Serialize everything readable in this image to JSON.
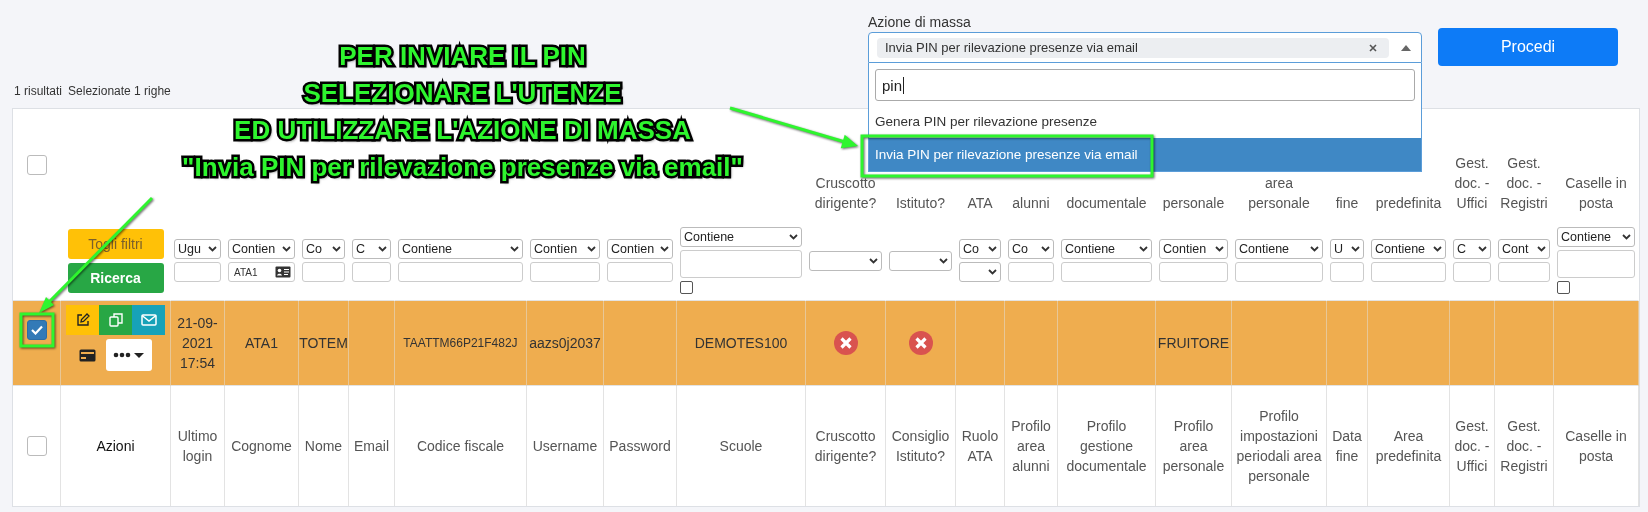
{
  "mass_action": {
    "label": "Azione di massa",
    "expanded": true,
    "value": "Invia PIN per rilevazione presenze via email",
    "search": "pin",
    "options": [
      {
        "label": "Genera PIN per rilevazione presenze",
        "selected": false
      },
      {
        "label": "Invia PIN per rilevazione presenze via email",
        "selected": true
      }
    ]
  },
  "proceed_button": "Procedi",
  "result_count": "1 risultati",
  "selection_info": "Selezionate 1 righe",
  "annotation": {
    "lines": [
      "PER INVIARE IL PIN",
      "SELEZIONARE L'UTENZE",
      "ED UTILIZZARE L'AZIONE DI MASSA",
      "\"Invia PIN per rilevazione presenze via email\""
    ]
  },
  "table": {
    "select_all_top": {
      "checked": false
    },
    "select_all_bottom": {
      "checked": false
    },
    "actions_label": "Azioni",
    "filter_buttons": [
      {
        "label": "Togli filtri",
        "kind": "clear"
      },
      {
        "label": "Ricerca",
        "kind": "search"
      }
    ],
    "columns": [
      {
        "label": "Ultimo login",
        "filter": {
          "kind": "select-input",
          "select": "Ugu"
        }
      },
      {
        "label": "Cognome",
        "filter": {
          "kind": "select-input",
          "select": "Contien",
          "value": "ATA1"
        }
      },
      {
        "label": "Nome",
        "filter": {
          "kind": "select-input",
          "select": "Co"
        }
      },
      {
        "label": "Email",
        "filter": {
          "kind": "select-input",
          "select": "C"
        }
      },
      {
        "label": "Codice fiscale",
        "filter": {
          "kind": "select-input",
          "select": "Contiene"
        }
      },
      {
        "label": "Username",
        "filter": {
          "kind": "select-input",
          "select": "Contien"
        }
      },
      {
        "label": "Password",
        "filter": {
          "kind": "select-input",
          "select": "Contien"
        }
      },
      {
        "label": "Scuole",
        "filter": {
          "kind": "select-textarea-check",
          "select": "Contiene",
          "checked": false
        }
      },
      {
        "label": "Cruscotto dirigente?",
        "top_label": "Cruscotto dirigente?",
        "filter": {
          "kind": "select"
        }
      },
      {
        "label": "Consiglio Istituto?",
        "top_label": "Istituto?",
        "filter": {
          "kind": "select"
        }
      },
      {
        "label": "Ruolo ATA",
        "top_label": "ATA",
        "filter": {
          "kind": "select-select",
          "select": "Co"
        }
      },
      {
        "label": "Profilo area alunni",
        "top_label": "alunni",
        "filter": {
          "kind": "select-input",
          "select": "Co"
        }
      },
      {
        "label": "Profilo gestione documentale",
        "top_label": "documentale",
        "filter": {
          "kind": "select-input",
          "select": "Contiene"
        }
      },
      {
        "label": "Profilo area personale",
        "top_label": "personale",
        "filter": {
          "kind": "select-input",
          "select": "Contien"
        }
      },
      {
        "label": "Profilo impostazioni periodali area personale",
        "top_label": "area personale",
        "filter": {
          "kind": "select-input",
          "select": "Contiene"
        }
      },
      {
        "label": "Data fine",
        "top_label": "fine",
        "filter": {
          "kind": "select-input",
          "select": "U"
        }
      },
      {
        "label": "Area predefinita",
        "top_label": "predefinita",
        "filter": {
          "kind": "select-input",
          "select": "Contiene"
        }
      },
      {
        "label": "Gest. doc. - Uffici",
        "top_label": "Gest. doc. - Uffici",
        "filter": {
          "kind": "select-input",
          "select": "C"
        }
      },
      {
        "label": "Gest. doc. - Registri",
        "top_label": "Gest. doc. - Registri",
        "filter": {
          "kind": "select-input",
          "select": "Cont"
        }
      },
      {
        "label": "Caselle in posta",
        "top_label": "Caselle in posta",
        "filter": {
          "kind": "select-textarea-check",
          "select": "Contiene",
          "checked": false
        }
      }
    ],
    "rows": [
      {
        "selected": true,
        "checked": true,
        "cells": [
          {
            "kind": "text",
            "text": "21-09-2021 17:54"
          },
          {
            "kind": "text",
            "text": "ATA1"
          },
          {
            "kind": "text",
            "text": "TOTEM"
          },
          null,
          {
            "kind": "code",
            "text": "TAATTM66P21F482J"
          },
          {
            "kind": "text",
            "text": "aazs0j2037"
          },
          null,
          {
            "kind": "text",
            "text": "DEMOTES100"
          },
          {
            "kind": "cross"
          },
          {
            "kind": "cross"
          },
          null,
          null,
          null,
          {
            "kind": "text",
            "text": "FRUITORE"
          },
          null,
          null,
          null,
          null,
          null,
          null
        ]
      }
    ]
  }
}
